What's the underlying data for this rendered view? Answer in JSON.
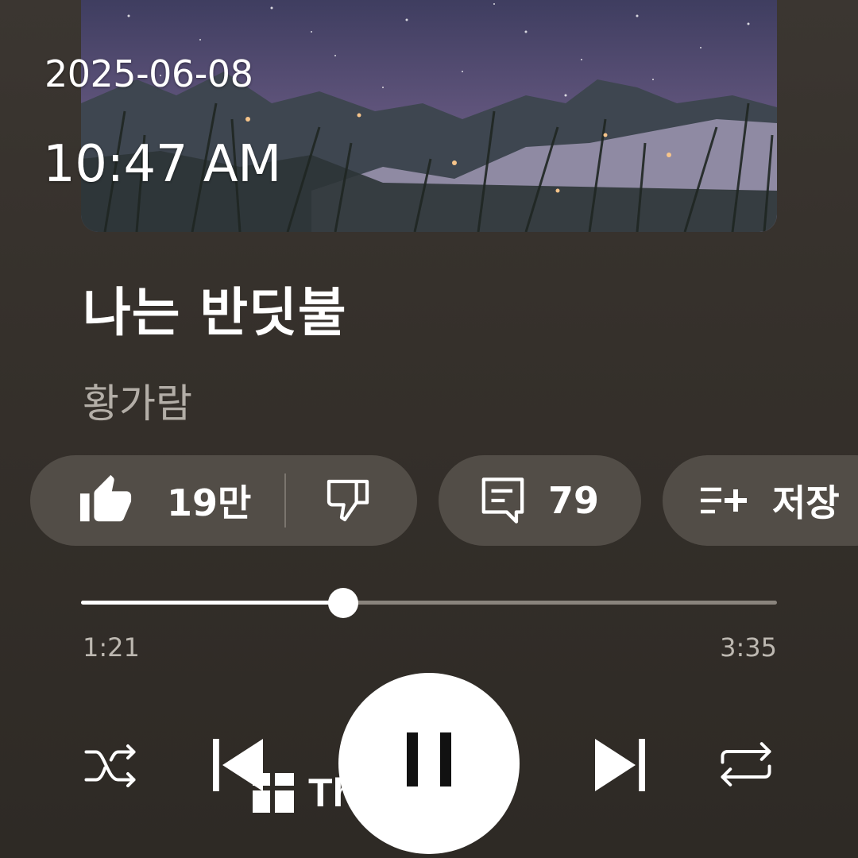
{
  "status": {
    "date": "2025-06-08",
    "time": "10:47 AM"
  },
  "track": {
    "title": "나는 반딧불",
    "artist": "황가람"
  },
  "actions": {
    "like_count": "19만",
    "comment_count": "79",
    "save_label": "저장"
  },
  "progress": {
    "current": "1:21",
    "total": "3:35",
    "fraction": 0.377
  },
  "watermark": {
    "text": "ThinkRead"
  },
  "icons": {
    "like": "thumb-up-icon",
    "dislike": "thumb-down-icon",
    "comment": "comment-icon",
    "save": "playlist-add-icon",
    "shuffle": "shuffle-icon",
    "previous": "skip-previous-icon",
    "pause": "pause-icon",
    "next": "skip-next-icon",
    "repeat": "repeat-icon"
  },
  "colors": {
    "background": "#36312c",
    "pill": "#524d47",
    "secondary_text": "#b3aea7"
  }
}
